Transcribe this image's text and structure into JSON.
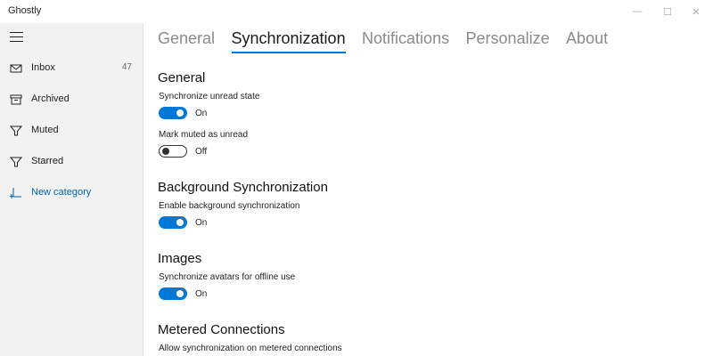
{
  "app": {
    "title": "Ghostly"
  },
  "window_controls": {
    "minimize": "—",
    "maximize": "☐",
    "close": "✕"
  },
  "sidebar": {
    "items": [
      {
        "label": "Inbox",
        "count": "47",
        "icon": "mail-icon"
      },
      {
        "label": "Archived",
        "icon": "archive-icon"
      },
      {
        "label": "Muted",
        "icon": "filter-icon"
      },
      {
        "label": "Starred",
        "icon": "filter-icon"
      },
      {
        "label": "New category",
        "icon": "new-category-icon"
      }
    ]
  },
  "tabs": [
    {
      "label": "General"
    },
    {
      "label": "Synchronization",
      "active": true
    },
    {
      "label": "Notifications"
    },
    {
      "label": "Personalize"
    },
    {
      "label": "About"
    }
  ],
  "sections": {
    "general": {
      "title": "General",
      "unread": {
        "label": "Synchronize unread state",
        "state": "On"
      },
      "muted": {
        "label": "Mark muted as unread",
        "state": "Off"
      }
    },
    "background": {
      "title": "Background Synchronization",
      "enable": {
        "label": "Enable background synchronization",
        "state": "On"
      }
    },
    "images": {
      "title": "Images",
      "avatars": {
        "label": "Synchronize avatars for offline use",
        "state": "On"
      }
    },
    "metered": {
      "title": "Metered Connections",
      "allow": {
        "label": "Allow synchronization on metered connections"
      }
    }
  },
  "colors": {
    "accent": "#0078d7",
    "link": "#0063b1",
    "sidebar_bg": "#f2f2f2"
  }
}
